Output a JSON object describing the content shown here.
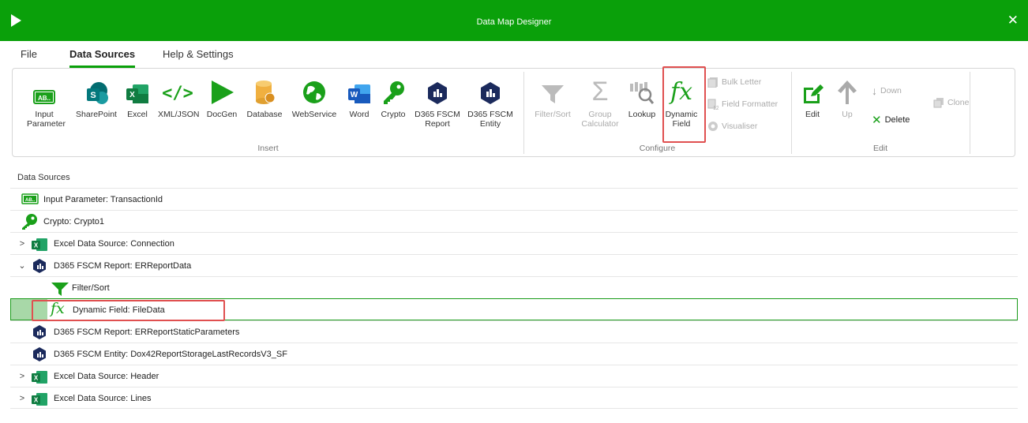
{
  "window": {
    "title": "Data Map Designer",
    "close_glyph": "✕"
  },
  "tabs": [
    {
      "label": "File"
    },
    {
      "label": "Data Sources"
    },
    {
      "label": "Help & Settings"
    }
  ],
  "ribbon": {
    "insert": {
      "group_label": "Insert",
      "buttons": [
        {
          "label": "Input\nParameter",
          "icon": "input-parameter-icon",
          "ab_text": "AB.."
        },
        {
          "label": "SharePoint",
          "icon": "sharepoint-icon",
          "glyph": "S"
        },
        {
          "label": "Excel",
          "icon": "excel-icon",
          "glyph": "X"
        },
        {
          "label": "XML/JSON",
          "icon": "code-icon",
          "glyph": "</>"
        },
        {
          "label": "DocGen",
          "icon": "play-icon"
        },
        {
          "label": "Database",
          "icon": "database-icon"
        },
        {
          "label": "WebService",
          "icon": "globe-icon"
        },
        {
          "label": "Word",
          "icon": "word-icon",
          "glyph": "W"
        },
        {
          "label": "Crypto",
          "icon": "key-icon"
        },
        {
          "label": "D365 FSCM\nReport",
          "icon": "d365-report-icon"
        },
        {
          "label": "D365 FSCM\nEntity",
          "icon": "d365-entity-icon"
        }
      ]
    },
    "configure": {
      "group_label": "Configure",
      "buttons": [
        {
          "label": "Filter/Sort",
          "icon": "funnel-icon",
          "enabled": false
        },
        {
          "label": "Group\nCalculator",
          "icon": "sigma-icon",
          "enabled": false,
          "glyph": "Σ"
        },
        {
          "label": "Lookup",
          "icon": "lookup-icon",
          "enabled": true
        },
        {
          "label": "Dynamic\nField",
          "icon": "fx-icon",
          "enabled": true,
          "glyph": "fx"
        }
      ],
      "small": [
        {
          "label": "Bulk Letter",
          "icon": "bulk-letter-icon"
        },
        {
          "label": "Field Formatter",
          "icon": "field-formatter-icon"
        },
        {
          "label": "Visualiser",
          "icon": "visualiser-icon"
        }
      ]
    },
    "edit": {
      "group_label": "Edit",
      "edit_label": "Edit",
      "up_label": "Up",
      "down_label": "Down",
      "delete_label": "Delete",
      "clone_label": "Clone"
    }
  },
  "data_sources": {
    "header": "Data Sources",
    "rows": [
      {
        "label": "Input Parameter: TransactionId",
        "icon": "input-parameter-icon",
        "level": 0,
        "expander": ""
      },
      {
        "label": "Crypto: Crypto1",
        "icon": "key-icon",
        "level": 0,
        "expander": ""
      },
      {
        "label": "Excel Data Source: Connection",
        "icon": "excel-icon",
        "level": 0,
        "expander": ">"
      },
      {
        "label": "D365 FSCM Report: ERReportData",
        "icon": "d365-report-icon",
        "level": 0,
        "expander": "⌄"
      },
      {
        "label": "Filter/Sort",
        "icon": "funnel-icon",
        "level": 1,
        "expander": ""
      },
      {
        "label": "Dynamic Field: FileData",
        "icon": "fx-icon",
        "level": 1,
        "expander": "",
        "selected": true
      },
      {
        "label": "D365 FSCM Report: ERReportStaticParameters",
        "icon": "d365-report-icon",
        "level": 0,
        "expander": ""
      },
      {
        "label": "D365 FSCM Entity: Dox42ReportStorageLastRecordsV3_SF",
        "icon": "d365-entity-icon",
        "level": 0,
        "expander": ""
      },
      {
        "label": "Excel Data Source: Header",
        "icon": "excel-icon",
        "level": 0,
        "expander": ">"
      },
      {
        "label": "Excel Data Source: Lines",
        "icon": "excel-icon",
        "level": 0,
        "expander": ">"
      }
    ]
  },
  "colors": {
    "brand_green": "#0aa00a",
    "highlight_red": "#e05050",
    "selection_green": "#a8d8a8"
  }
}
